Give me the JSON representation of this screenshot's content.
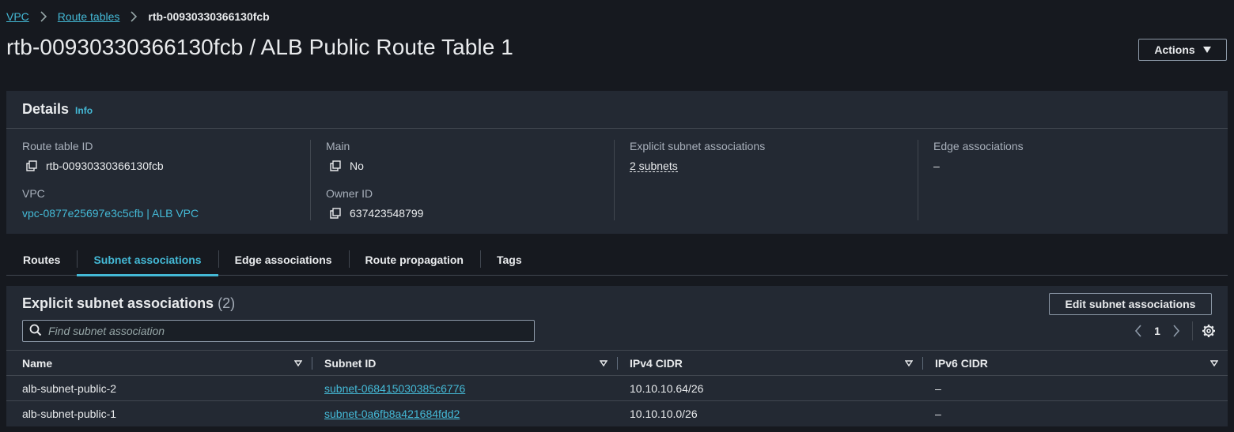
{
  "breadcrumb": {
    "items": [
      "VPC",
      "Route tables"
    ],
    "current": "rtb-00930330366130fcb"
  },
  "page_title": "rtb-00930330366130fcb / ALB Public Route Table 1",
  "actions_label": "Actions",
  "details": {
    "title": "Details",
    "info": "Info",
    "route_table_id_label": "Route table ID",
    "route_table_id": "rtb-00930330366130fcb",
    "vpc_label": "VPC",
    "vpc": "vpc-0877e25697e3c5cfb | ALB VPC",
    "main_label": "Main",
    "main": "No",
    "owner_id_label": "Owner ID",
    "owner_id": "637423548799",
    "explicit_label": "Explicit subnet associations",
    "explicit": "2 subnets",
    "edge_label": "Edge associations",
    "edge": "–"
  },
  "tabs": [
    "Routes",
    "Subnet associations",
    "Edge associations",
    "Route propagation",
    "Tags"
  ],
  "active_tab": "Subnet associations",
  "subnets": {
    "title": "Explicit subnet associations",
    "count": "(2)",
    "edit_label": "Edit subnet associations",
    "search_placeholder": "Find subnet association",
    "page": "1",
    "columns": [
      "Name",
      "Subnet ID",
      "IPv4 CIDR",
      "IPv6 CIDR"
    ],
    "rows": [
      {
        "name": "alb-subnet-public-2",
        "subnet_id": "subnet-068415030385c6776",
        "ipv4": "10.10.10.64/26",
        "ipv6": "–"
      },
      {
        "name": "alb-subnet-public-1",
        "subnet_id": "subnet-0a6fb8a421684fdd2",
        "ipv4": "10.10.10.0/26",
        "ipv6": "–"
      }
    ]
  },
  "colors": {
    "background": "#16191f",
    "panel": "#232933",
    "accent": "#44b9d6",
    "border": "#414750"
  }
}
